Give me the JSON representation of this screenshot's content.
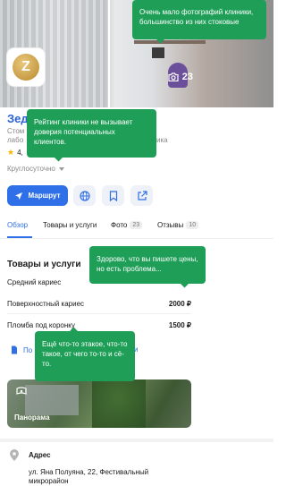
{
  "hero": {
    "photo_count": "23"
  },
  "clinic": {
    "name_fragment": "Зед",
    "subtitle_line1_fragment": "Стом",
    "subtitle_line2_fragment": "лабо",
    "subtitle_right_fragment": "ика",
    "rating_fragment": "4,",
    "hours": "Круглосуточно"
  },
  "actions": {
    "route_label": "Маршрут"
  },
  "tabs": [
    {
      "label": "Обзор",
      "active": true
    },
    {
      "label": "Товары и услуги"
    },
    {
      "label": "Фото",
      "count": "23"
    },
    {
      "label": "Отзывы",
      "count": "10"
    }
  ],
  "services": {
    "section_title": "Товары и услуги",
    "category": "Средний кариес",
    "rows": [
      {
        "name": "Поверхностный кариес",
        "price": "2000 ₽"
      },
      {
        "name": "Пломба под коронку",
        "price": "1500 ₽"
      }
    ],
    "link_start": "По",
    "link_end": "и"
  },
  "panorama": {
    "label": "Панорама"
  },
  "address": {
    "label": "Адрес",
    "line1": "ул. Яна Полуяна, 22, Фестивальный",
    "line2": "микрорайон"
  },
  "comments": [
    "Очень мало фотографий клиники, большинство из них стоковые",
    "Рейтинг клиники не вызывает доверия потенциальных клиентов.",
    "Здорово, что вы пишете цены, но есть проблема...",
    "Ещё что-то этакое, что-то такое, от чего то-то и сё-то."
  ],
  "colors": {
    "accent": "#2f6fe8",
    "comment_bg": "#1e9e57",
    "star": "#f5b700"
  }
}
